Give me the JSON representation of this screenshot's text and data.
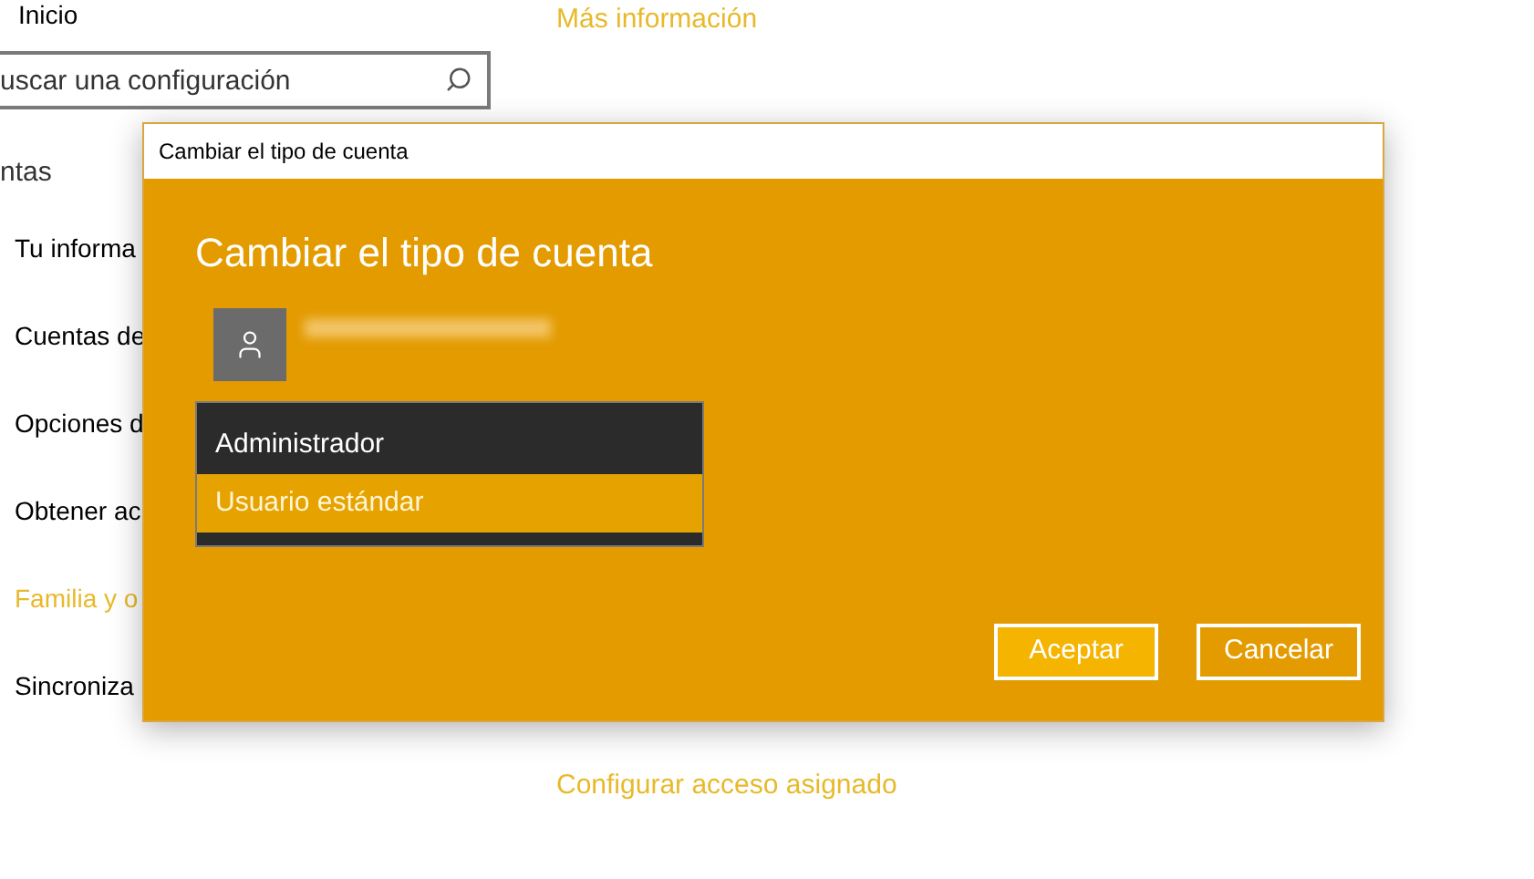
{
  "sidebar": {
    "home": "Inicio",
    "search": {
      "placeholder": "uscar una configuración"
    },
    "section": "ntas",
    "items": [
      {
        "label": "Tu informa",
        "selected": false
      },
      {
        "label": "Cuentas de",
        "selected": false
      },
      {
        "label": "Opciones d",
        "selected": false
      },
      {
        "label": "Obtener ac",
        "selected": false
      },
      {
        "label": "Familia y o",
        "selected": true
      },
      {
        "label": "Sincroniza",
        "selected": false
      }
    ]
  },
  "content": {
    "top_link": "Más información",
    "bottom_link": "Configurar acceso asignado"
  },
  "dialog": {
    "title": "Cambiar el tipo de cuenta",
    "heading": "Cambiar el tipo de cuenta",
    "options": [
      {
        "label": "Administrador",
        "selected": false
      },
      {
        "label": "Usuario estándar",
        "selected": true
      }
    ],
    "buttons": [
      {
        "label": "Aceptar",
        "kind": "primary"
      },
      {
        "label": "Cancelar",
        "kind": "secondary"
      }
    ]
  }
}
